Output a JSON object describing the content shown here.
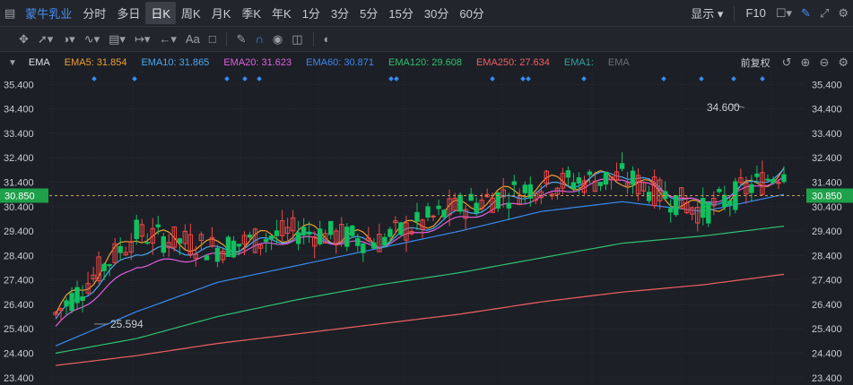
{
  "topbar": {
    "stock_name": "蒙牛乳业",
    "periods": [
      "分时",
      "多日",
      "日K",
      "周K",
      "月K",
      "季K",
      "年K",
      "1分",
      "3分",
      "5分",
      "15分",
      "30分",
      "60分"
    ],
    "active_period": "日K",
    "display_label": "显示",
    "f10_label": "F10"
  },
  "toolbar": {
    "text_tool": "Aa"
  },
  "indicator": {
    "name": "EMA",
    "ema": [
      {
        "label": "EMA5: 31.854",
        "color": "#f0a030"
      },
      {
        "label": "EMA10: 31.865",
        "color": "#4aa8f0"
      },
      {
        "label": "EMA20: 31.623",
        "color": "#e060e0"
      },
      {
        "label": "EMA60: 30.871",
        "color": "#3a8af0"
      },
      {
        "label": "EMA120: 29.608",
        "color": "#30c070"
      },
      {
        "label": "EMA250: 27.634",
        "color": "#f06060"
      },
      {
        "label": "EMA1:",
        "color": "#2fa4a0"
      },
      {
        "label": "EMA",
        "color": "#6a6f78"
      }
    ],
    "adjust_label": "前复权"
  },
  "chart_data": {
    "type": "candlestick",
    "ylim": [
      23.1,
      35.85
    ],
    "y_ticks_left": [
      "35.400",
      "34.400",
      "33.400",
      "32.400",
      "31.400",
      "30.400",
      "29.400",
      "28.400",
      "27.400",
      "26.400",
      "25.400",
      "24.400",
      "23.400"
    ],
    "y_ticks_right": [
      "35.400",
      "34.400",
      "33.400",
      "32.400",
      "31.400",
      "30.400",
      "29.400",
      "28.400",
      "27.400",
      "26.400",
      "25.400",
      "24.400",
      "23.400"
    ],
    "current_price": "30.850",
    "annotations": {
      "high": "34.600",
      "low": "25.594"
    },
    "colors": {
      "up": "#f04848",
      "down": "#10c060"
    },
    "candle_count": 136,
    "ema_series": [
      {
        "name": "EMA5",
        "color": "#f0a030",
        "x": [
          0,
          15,
          30,
          45,
          60,
          75,
          90,
          105,
          120,
          135
        ],
        "y": [
          26.0,
          29.3,
          28.7,
          29.4,
          29.0,
          30.4,
          31.3,
          31.6,
          30.2,
          31.9
        ]
      },
      {
        "name": "EMA10",
        "color": "#4aa8f0",
        "x": [
          0,
          15,
          30,
          45,
          60,
          75,
          90,
          105,
          120,
          135
        ],
        "y": [
          25.8,
          28.6,
          28.6,
          29.2,
          28.9,
          30.1,
          31.1,
          31.8,
          30.4,
          31.9
        ]
      },
      {
        "name": "EMA20",
        "color": "#e060e0",
        "x": [
          0,
          15,
          30,
          45,
          60,
          75,
          90,
          105,
          120,
          135
        ],
        "y": [
          25.5,
          28.0,
          28.4,
          29.1,
          28.8,
          29.9,
          30.8,
          31.6,
          30.5,
          31.6
        ]
      },
      {
        "name": "EMA60",
        "color": "#3a8af0",
        "x": [
          0,
          15,
          30,
          45,
          60,
          75,
          90,
          105,
          120,
          135
        ],
        "y": [
          24.7,
          26.1,
          27.3,
          28.0,
          28.7,
          29.4,
          30.2,
          30.6,
          30.2,
          30.9
        ]
      },
      {
        "name": "EMA120",
        "color": "#30c070",
        "x": [
          0,
          15,
          30,
          45,
          60,
          75,
          90,
          105,
          120,
          135
        ],
        "y": [
          24.4,
          25.0,
          25.9,
          26.6,
          27.2,
          27.7,
          28.3,
          28.9,
          29.2,
          29.6
        ]
      },
      {
        "name": "EMA250",
        "color": "#f06060",
        "x": [
          0,
          15,
          30,
          45,
          60,
          75,
          90,
          105,
          120,
          135
        ],
        "y": [
          23.9,
          24.3,
          24.8,
          25.2,
          25.6,
          26.0,
          26.5,
          26.9,
          27.2,
          27.63
        ]
      }
    ]
  }
}
